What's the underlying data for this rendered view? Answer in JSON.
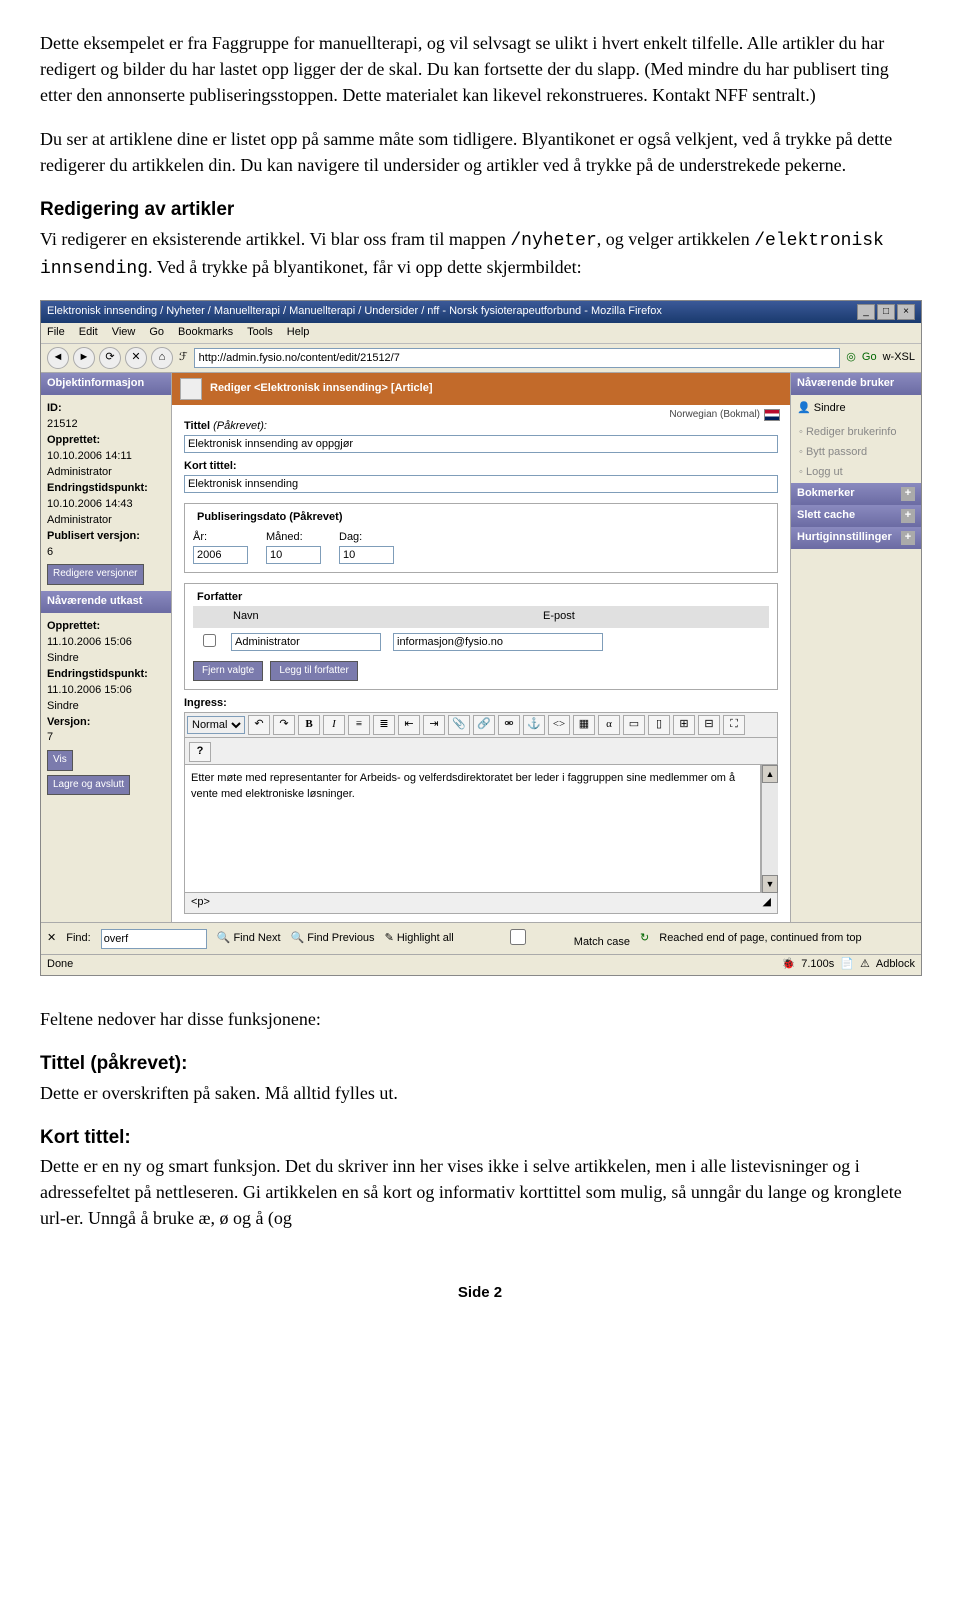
{
  "intro": {
    "p1": "Dette eksempelet er fra Faggruppe for manuellterapi, og vil selvsagt se ulikt i hvert enkelt tilfelle. Alle artikler du har redigert og bilder du har lastet opp ligger der de skal. Du kan fortsette der du slapp. (Med mindre du har publisert ting etter den annonserte publiseringsstoppen. Dette materialet kan likevel rekonstrueres. Kontakt NFF sentralt.)",
    "p2": "Du ser at artiklene dine er listet opp på samme måte som tidligere. Blyantikonet er også velkjent, ved å trykke på dette redigerer du artikkelen din. Du kan navigere til undersider og artikler ved å trykke på de understrekede pekerne."
  },
  "section1": {
    "heading": "Redigering av artikler",
    "text_a": "Vi redigerer en eksisterende artikkel. Vi blar oss fram til mappen ",
    "mono_a": "/nyheter",
    "text_b": ", og velger artikkelen ",
    "mono_b": "/elektronisk innsending",
    "text_c": ". Ved å trykke på blyantikonet, får vi opp dette skjermbildet:"
  },
  "shot": {
    "title": "Elektronisk innsending / Nyheter / Manuellterapi / Manuellterapi / Undersider / nff - Norsk fysioterapeutforbund - Mozilla Firefox",
    "menus": [
      "File",
      "Edit",
      "View",
      "Go",
      "Bookmarks",
      "Tools",
      "Help"
    ],
    "url": "http://admin.fysio.no/content/edit/21512/7",
    "go": "Go",
    "xsl": "w-XSL",
    "left": {
      "objinfo_head": "Objektinformasjon",
      "id_lbl": "ID:",
      "id_val": "21512",
      "opprettet_lbl": "Opprettet:",
      "opprettet_val": "10.10.2006 14:11",
      "opprettet_by": "Administrator",
      "endr_lbl": "Endringstidspunkt:",
      "endr_val": "10.10.2006 14:43",
      "endr_by": "Administrator",
      "pub_lbl": "Publisert versjon:",
      "pub_val": "6",
      "btn_versions": "Redigere versjoner",
      "utkast_head": "Nåværende utkast",
      "u_opp_lbl": "Opprettet:",
      "u_opp_val": "11.10.2006 15:06",
      "u_opp_by": "Sindre",
      "u_endr_lbl": "Endringstidspunkt:",
      "u_endr_val": "11.10.2006 15:06",
      "u_endr_by": "Sindre",
      "ver_lbl": "Versjon:",
      "ver_val": "7",
      "btn_vis": "Vis",
      "btn_lagre": "Lagre og avslutt"
    },
    "center": {
      "header": "Rediger <Elektronisk innsending> [Article]",
      "lang": "Norwegian (Bokmal)",
      "tittel_lbl": "Tittel",
      "pakrevet": " (Påkrevet):",
      "tittel_val": "Elektronisk innsending av oppgjør",
      "kort_lbl": "Kort tittel:",
      "kort_val": "Elektronisk innsending",
      "pubdato_lbl": "Publiseringsdato (Påkrevet)",
      "ar": "År:",
      "ar_val": "2006",
      "mnd": "Måned:",
      "mnd_val": "10",
      "dag": "Dag:",
      "dag_val": "10",
      "forfatter_lbl": "Forfatter",
      "navn": "Navn",
      "epost": "E-post",
      "author_name": "Administrator",
      "author_mail": "informasjon@fysio.no",
      "fjern": "Fjern valgte",
      "legg": "Legg til forfatter",
      "ingress_lbl": "Ingress:",
      "normal": "Normal",
      "help": "?",
      "editor_text": "Etter møte med representanter for Arbeids- og velferdsdirektoratet ber leder i faggruppen sine medlemmer om å vente med elektroniske løsninger.",
      "status_p": "<p>"
    },
    "right": {
      "bruker_head": "Nåværende bruker",
      "bruker_name": "Sindre",
      "link1": "Rediger brukerinfo",
      "link2": "Bytt passord",
      "link3": "Logg ut",
      "bokmerker": "Bokmerker",
      "slett": "Slett cache",
      "hurtig": "Hurtiginnstillinger"
    },
    "find": {
      "lbl": "Find:",
      "val": "overf",
      "next": "Find Next",
      "prev": "Find Previous",
      "hl": "Highlight all",
      "match": "Match case",
      "msg": "Reached end of page, continued from top"
    },
    "status": {
      "done": "Done",
      "time": "7.100s",
      "adblock": "Adblock"
    }
  },
  "after": {
    "p1": "Feltene nedover har disse funksjonene:",
    "h2": "Tittel (påkrevet):",
    "p2": "Dette er overskriften på saken. Må alltid fylles ut.",
    "h3": "Kort tittel:",
    "p3": "Dette er en ny og smart funksjon. Det du skriver inn her vises ikke i selve artikkelen, men i alle listevisninger og i adressefeltet på nettleseren. Gi artikkelen en så kort og informativ korttittel som mulig, så unngår du lange og kronglete url-er. Unngå å bruke æ, ø og å (og"
  },
  "footer": "Side 2"
}
